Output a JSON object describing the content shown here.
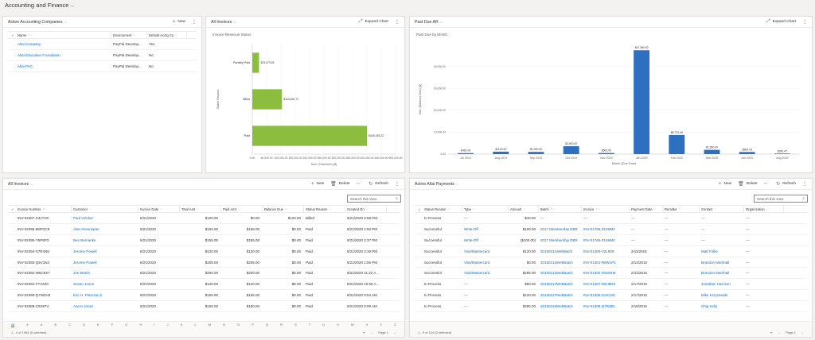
{
  "app": {
    "title": "Accounting and Finance"
  },
  "companies": {
    "title": "Active Accounting Companies",
    "new_label": "New",
    "columns": [
      "Name",
      "Environment",
      "Default Acctg Co"
    ],
    "rows": [
      {
        "name": "Altai Company",
        "env": "PayPal Develop...",
        "def": "Yes"
      },
      {
        "name": "Altai Education Foundation",
        "env": "PayPal Develop...",
        "def": "No"
      },
      {
        "name": "Altai PAC",
        "env": "PayPal Develop...",
        "def": "No"
      }
    ]
  },
  "invoices_chart": {
    "title": "All Invoices",
    "expand_label": "Expand Chart",
    "chart_title": "Invoice Revenue Status",
    "chart_data": {
      "type": "bar",
      "orientation": "horizontal",
      "title": "Invoice Revenue Status",
      "xlabel": "Sum (Total Amt) ($)",
      "ylabel": "Status Reason",
      "categories": [
        "Partially Paid",
        "Billed",
        "Paid"
      ],
      "values": [
        23473.45,
        103634.71,
        400195.22
      ],
      "data_labels": [
        "$23,473.45",
        "$103,634.71",
        "$400,195.22"
      ],
      "xlim": [
        0,
        500000
      ],
      "xticks": [
        "0.00",
        "50,000.00",
        "100,000.00",
        "150,000.00",
        "200,000.00",
        "250,000.00",
        "300,000.00",
        "350,000.00",
        "400,000.00",
        "450,000.00",
        "500,000.00"
      ],
      "color": "#8cbd3f"
    }
  },
  "past_due_chart": {
    "title": "Past Due AR",
    "expand_label": "Expand Chart",
    "chart_title": "Past Due by Month",
    "chart_data": {
      "type": "bar",
      "title": "Past Due by Month",
      "xlabel": "Month (Due Date)",
      "ylabel": "Sum (Balance Due) ($)",
      "categories": [
        "Jul 2019",
        "Aug 2019",
        "Sep 2019",
        "Oct 2019",
        "Nov 2019",
        "Jan 2020",
        "Feb 2020",
        "Mar 2020",
        "Jun 2020",
        "Aug 2020"
      ],
      "values": [
        462,
        1120,
        1000,
        3600,
        500,
        47380,
        8731.49,
        1950,
        964.43,
        260.47
      ],
      "data_labels": [
        "$462.00",
        "$1120.00",
        "$1,000.00",
        "$3,600.00",
        "$500.00",
        "$47,380.00",
        "$8,731.49",
        "$1,950.00",
        "$964.43",
        "$260.47"
      ],
      "ylim": [
        0,
        50000
      ],
      "yticks": [
        "0.00",
        "10,000.00",
        "20,000.00",
        "30,000.00",
        "40,000.00"
      ],
      "color": "#2e6fbf"
    }
  },
  "all_invoices": {
    "title": "All Invoices",
    "new_label": "New",
    "delete_label": "Delete",
    "refresh_label": "Refresh",
    "search_placeholder": "Search this view",
    "columns": [
      "Invoice Number",
      "Customer",
      "Invoice Date",
      "Total Amt",
      "Paid Amt",
      "Balance Due",
      "Status Reason",
      "Created On"
    ],
    "rows": [
      [
        "INV-02387-C4LTV8",
        "Paul Volcker",
        "8/21/2020",
        "$120.00",
        "$0.00",
        "$120.00",
        "Billed",
        "8/21/2020 2:58 PM"
      ],
      [
        "INV-02396-M0P3C9",
        "Alan Greenspan",
        "8/21/2020",
        "$155.00",
        "$155.00",
        "$0.00",
        "Paid",
        "8/21/2020 2:50 PM"
      ],
      [
        "INV-02395-Y5P8P3",
        "Ben Bernanke",
        "8/21/2020",
        "$155.00",
        "$155.00",
        "$0.00",
        "Paid",
        "8/21/2020 2:37 PM"
      ],
      [
        "INV-02394-S7R4N8",
        "Jerome Powell",
        "8/21/2020",
        "$120.00",
        "$120.00",
        "$0.00",
        "Paid",
        "8/21/2020 2:19 PM"
      ],
      [
        "INV-02393-Q5V1N2",
        "Jerome Powell",
        "8/21/2020",
        "$205.00",
        "$205.00",
        "$0.00",
        "Paid",
        "8/21/2020 1:55 PM"
      ],
      [
        "INV-02392-W6C8X7",
        "Jon Martin",
        "8/21/2020",
        "$200.00",
        "$200.00",
        "$0.00",
        "Paid",
        "8/21/2020 11:22 A..."
      ],
      [
        "INV-02391-F7V2Z0",
        "Susan Jones",
        "8/21/2020",
        "$120.00",
        "$120.00",
        "$0.00",
        "Paid",
        "8/21/2020 10:55 A..."
      ],
      [
        "INV-02390-Q7W2H3",
        "Eric H. Peterson II",
        "8/21/2020",
        "$155.00",
        "$155.00",
        "$0.00",
        "Paid",
        "8/21/2020 9:54 AM"
      ],
      [
        "INV-02389-C5S8T4",
        "Aaron Jones",
        "8/21/2020",
        "$150.00",
        "$150.00",
        "$0.00",
        "Paid",
        "8/21/2020 9:09 AM"
      ]
    ],
    "alphabet": [
      "All",
      "#",
      "A",
      "B",
      "C",
      "D",
      "E",
      "F",
      "G",
      "H",
      "I",
      "J",
      "K",
      "L",
      "M",
      "N",
      "O",
      "P",
      "Q",
      "R",
      "S",
      "T",
      "U",
      "V",
      "W",
      "X",
      "Y",
      "Z"
    ],
    "footer_text": "1 - 4 of 1994 (0 selected)",
    "page_label": "Page 1"
  },
  "payments": {
    "title": "Active Altai Payments",
    "new_label": "New",
    "delete_label": "Delete",
    "refresh_label": "Refresh",
    "search_placeholder": "Search this view",
    "columns": [
      "Status Reason",
      "Type",
      "Amount",
      "Batch",
      "Invoice",
      "Payment Date",
      "Remitter",
      "Contact",
      "Organization"
    ],
    "rows": [
      [
        "In Process",
        "---",
        "$40.00",
        "---",
        "---",
        "---",
        "---",
        "---",
        "---"
      ],
      [
        "Successful",
        "Write-Off",
        "$100.00",
        "2017 Membership DBR",
        "INV-01765-Z1X8M2",
        "---",
        "---",
        "---",
        "---"
      ],
      [
        "Successful",
        "Write-Off",
        "($100.00)",
        "2017 Membership DBR",
        "INV-01765-Z1X8M2",
        "---",
        "---",
        "---",
        "---"
      ],
      [
        "Successful",
        "Visa/Mastercard",
        "$120.00",
        "20150211WebBatch",
        "INV-01300-V2L9Z8",
        "2/11/2015",
        "---",
        "Matt Follie",
        "---"
      ],
      [
        "Successful",
        "Visa/Mastercard",
        "$0.00",
        "20150212WebBatch",
        "INV-01301-R8W1P1",
        "2/12/2015",
        "---",
        "Brandon Marshall",
        "---"
      ],
      [
        "Successful",
        "Visa/Mastercard",
        "$285.00",
        "20150212WebBatch",
        "INV-01302-G8G8H8",
        "2/12/2015",
        "---",
        "Brandon Marshall",
        "---"
      ],
      [
        "In Process",
        "---",
        "$50.00",
        "20150217WebBatch",
        "INV-01307-N5H8R8",
        "2/17/2015",
        "---",
        "Jonathan Harrison",
        "---"
      ],
      [
        "In Process",
        "---",
        "$120.00",
        "20150217WebBatch",
        "INV-01308-G2S1X0",
        "2/17/2015",
        "---",
        "Mike Krzyzewski",
        "---"
      ],
      [
        "In Process",
        "---",
        "$305.00",
        "20150218WebBatch",
        "INV-01309-Q7R3B1",
        "2/18/2015",
        "---",
        "Chip Kelly",
        "---"
      ]
    ],
    "footer_text": "1 - 9 of 144 (0 selected)",
    "page_label": "Page 1"
  }
}
